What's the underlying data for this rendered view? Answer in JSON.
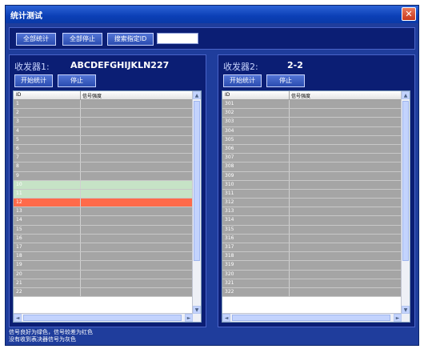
{
  "window": {
    "title": "统计测试",
    "close_glyph": "✕"
  },
  "toolbar": {
    "stat_all_label": "全部统计",
    "stop_all_label": "全部停止",
    "search_id_label": "搜索指定ID",
    "id_input_value": ""
  },
  "receiver1": {
    "label": "收发器1:",
    "value": "ABCDEFGHIJKLN227",
    "start_label": "开始统计",
    "stop_label": "停止",
    "columns": [
      "ID",
      "信号强度"
    ],
    "rows": [
      {
        "id": "1",
        "status": "gray"
      },
      {
        "id": "2",
        "status": "gray"
      },
      {
        "id": "3",
        "status": "gray"
      },
      {
        "id": "4",
        "status": "gray"
      },
      {
        "id": "5",
        "status": "gray"
      },
      {
        "id": "6",
        "status": "gray"
      },
      {
        "id": "7",
        "status": "gray"
      },
      {
        "id": "8",
        "status": "gray"
      },
      {
        "id": "9",
        "status": "gray"
      },
      {
        "id": "10",
        "status": "green"
      },
      {
        "id": "11",
        "status": "green"
      },
      {
        "id": "12",
        "status": "red"
      },
      {
        "id": "13",
        "status": "gray"
      },
      {
        "id": "14",
        "status": "gray"
      },
      {
        "id": "15",
        "status": "gray"
      },
      {
        "id": "16",
        "status": "gray"
      },
      {
        "id": "17",
        "status": "gray"
      },
      {
        "id": "18",
        "status": "gray"
      },
      {
        "id": "19",
        "status": "gray"
      },
      {
        "id": "20",
        "status": "gray"
      },
      {
        "id": "21",
        "status": "gray"
      },
      {
        "id": "22",
        "status": "gray"
      }
    ]
  },
  "receiver2": {
    "label": "收发器2:",
    "value": "2-2",
    "start_label": "开始统计",
    "stop_label": "停止",
    "columns": [
      "ID",
      "信号强度"
    ],
    "rows": [
      {
        "id": "301",
        "status": "gray"
      },
      {
        "id": "302",
        "status": "gray"
      },
      {
        "id": "303",
        "status": "gray"
      },
      {
        "id": "304",
        "status": "gray"
      },
      {
        "id": "305",
        "status": "gray"
      },
      {
        "id": "306",
        "status": "gray"
      },
      {
        "id": "307",
        "status": "gray"
      },
      {
        "id": "308",
        "status": "gray"
      },
      {
        "id": "309",
        "status": "gray"
      },
      {
        "id": "310",
        "status": "gray"
      },
      {
        "id": "311",
        "status": "gray"
      },
      {
        "id": "312",
        "status": "gray"
      },
      {
        "id": "313",
        "status": "gray"
      },
      {
        "id": "314",
        "status": "gray"
      },
      {
        "id": "315",
        "status": "gray"
      },
      {
        "id": "316",
        "status": "gray"
      },
      {
        "id": "317",
        "status": "gray"
      },
      {
        "id": "318",
        "status": "gray"
      },
      {
        "id": "319",
        "status": "gray"
      },
      {
        "id": "320",
        "status": "gray"
      },
      {
        "id": "321",
        "status": "gray"
      },
      {
        "id": "322",
        "status": "gray"
      }
    ]
  },
  "footer": {
    "line1": "信号良好为绿色，信号较差为红色",
    "line2": "没有收到表决器信号为灰色"
  },
  "colors": {
    "gray": "#a5a5a5",
    "green": "#c6e3c6",
    "red": "#ff6a4a",
    "window": "#1f3d9c"
  },
  "icons": {
    "scroll_up": "▲",
    "scroll_down": "▼",
    "scroll_left": "◄",
    "scroll_right": "►"
  }
}
